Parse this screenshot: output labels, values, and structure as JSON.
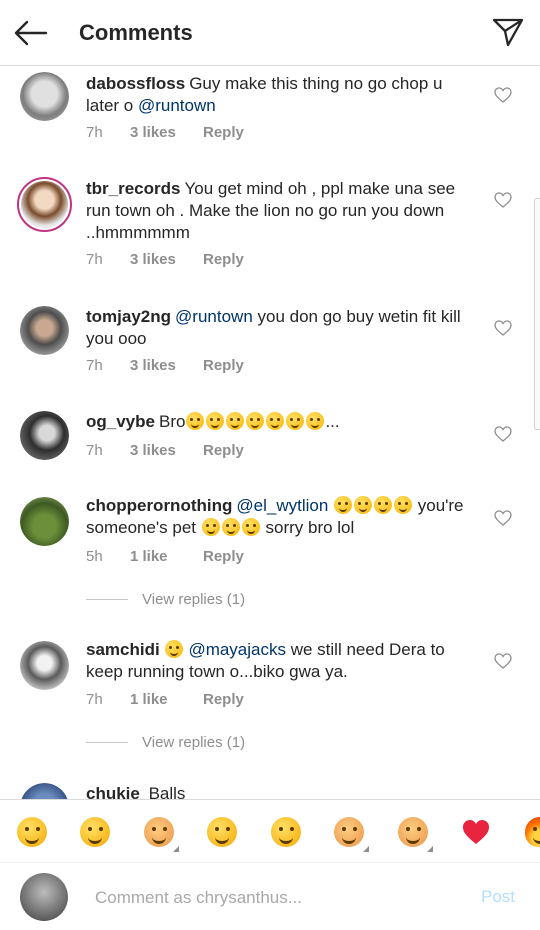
{
  "header": {
    "title": "Comments",
    "back_icon": "arrow-left-icon",
    "send_icon": "paper-plane-icon"
  },
  "comments": [
    {
      "username": "dabossfloss",
      "segments": [
        {
          "text": "Guy make this thing no go chop u later o "
        },
        {
          "text": "@runtown",
          "mention": true
        }
      ],
      "time": "7h",
      "likes": "3 likes",
      "reply": "Reply"
    },
    {
      "username": "tbr_records",
      "segments": [
        {
          "text": "You get mind oh , ppl make una see run town oh . Make the lion no go run you down ..hmmmmmm"
        }
      ],
      "time": "7h",
      "likes": "3 likes",
      "reply": "Reply"
    },
    {
      "username": "tomjay2ng",
      "segments": [
        {
          "text": "@runtown",
          "mention": true
        },
        {
          "text": " you don go buy wetin fit kill you ooo"
        }
      ],
      "time": "7h",
      "likes": "3 likes",
      "reply": "Reply"
    },
    {
      "username": "og_vybe",
      "segments": [
        {
          "text": "Bro"
        },
        {
          "emoji": 7
        },
        {
          "text": "..."
        }
      ],
      "time": "7h",
      "likes": "3 likes",
      "reply": "Reply"
    },
    {
      "username": "chopperornothing",
      "segments": [
        {
          "text": "@el_wytlion",
          "mention": true
        },
        {
          "text": " "
        },
        {
          "emoji": 4
        },
        {
          "text": " you're someone's pet "
        },
        {
          "emoji": 3
        },
        {
          "text": " sorry bro lol"
        }
      ],
      "time": "5h",
      "likes": "1 like",
      "reply": "Reply",
      "view_replies": "View replies (1)"
    },
    {
      "username": "samchidi",
      "segments": [
        {
          "emoji": 1
        },
        {
          "text": " "
        },
        {
          "text": "@mayajacks",
          "mention": true
        },
        {
          "text": " we still need Dera to keep running town o...biko gwa ya."
        }
      ],
      "time": "7h",
      "likes": "1 like",
      "reply": "Reply",
      "view_replies": "View replies (1)"
    },
    {
      "username": "chukie",
      "segments": [
        {
          "text": "  Balls"
        }
      ]
    }
  ],
  "emoji_bar": [
    {
      "name": "tears-of-joy-emoji",
      "has_variants": false
    },
    {
      "name": "rofl-emoji",
      "has_variants": false
    },
    {
      "name": "raising-hands-emoji",
      "has_variants": true
    },
    {
      "name": "rolling-eyes-emoji",
      "has_variants": false
    },
    {
      "name": "grinning-emoji",
      "has_variants": false
    },
    {
      "name": "ok-hand-emoji",
      "has_variants": true
    },
    {
      "name": "fist-bump-emoji",
      "has_variants": true
    },
    {
      "name": "red-heart-emoji",
      "has_variants": false
    },
    {
      "name": "fire-emoji",
      "has_variants": false
    }
  ],
  "input": {
    "placeholder": "Comment as chrysanthus...",
    "post_label": "Post"
  },
  "colors": {
    "mention": "#003569",
    "meta": "#8e8e8e",
    "post_disabled": "#b2dffc",
    "story_ring": "#c13584"
  }
}
